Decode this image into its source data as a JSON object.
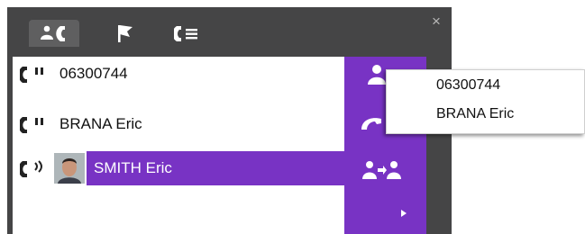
{
  "tabs": [
    {
      "icon": "contacts-call-icon",
      "active": true
    },
    {
      "icon": "flag-icon",
      "active": false
    },
    {
      "icon": "call-list-icon",
      "active": false
    }
  ],
  "close_label": "×",
  "calls": [
    {
      "label": "06300744",
      "status": "on-hold",
      "active": false
    },
    {
      "label": "BRANA Eric",
      "status": "on-hold",
      "active": true
    },
    {
      "label": "SMITH Eric",
      "status": "ringing",
      "active": true,
      "has_avatar": true
    }
  ],
  "actions": [
    {
      "icon": "contact-icon"
    },
    {
      "icon": "handset-icon"
    },
    {
      "icon": "transfer-icon"
    },
    {
      "icon": "more-arrow-icon"
    }
  ],
  "dropdown": {
    "items": [
      "06300744",
      "BRANA Eric"
    ]
  },
  "colors": {
    "accent": "#7833c4",
    "panel": "#454546",
    "tab_active": "#5f5f60"
  }
}
